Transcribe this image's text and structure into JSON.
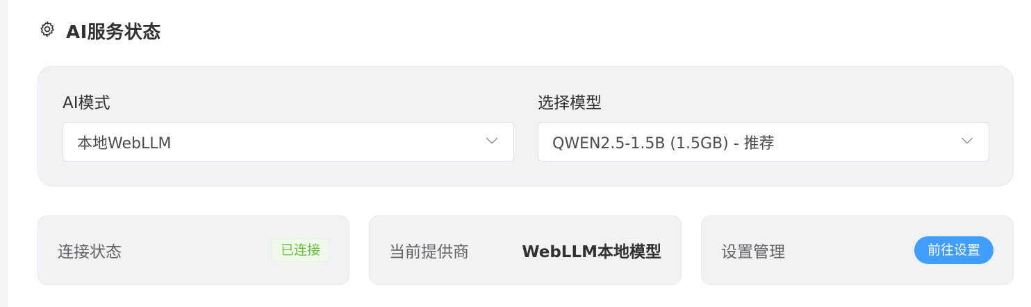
{
  "header": {
    "title": "AI服务状态",
    "icon": "gear-icon"
  },
  "config": {
    "mode": {
      "label": "AI模式",
      "value": "本地WebLLM",
      "icon": "chevron-down-icon"
    },
    "model": {
      "label": "选择模型",
      "value": "QWEN2.5-1.5B (1.5GB) - 推荐",
      "icon": "chevron-down-icon"
    }
  },
  "stats": {
    "connection": {
      "label": "连接状态",
      "badge": "已连接",
      "badge_color": "#67c23a"
    },
    "provider": {
      "label": "当前提供商",
      "value": "WebLLM本地模型"
    },
    "settings": {
      "label": "设置管理",
      "button": "前往设置",
      "button_color": "#409eff"
    }
  }
}
